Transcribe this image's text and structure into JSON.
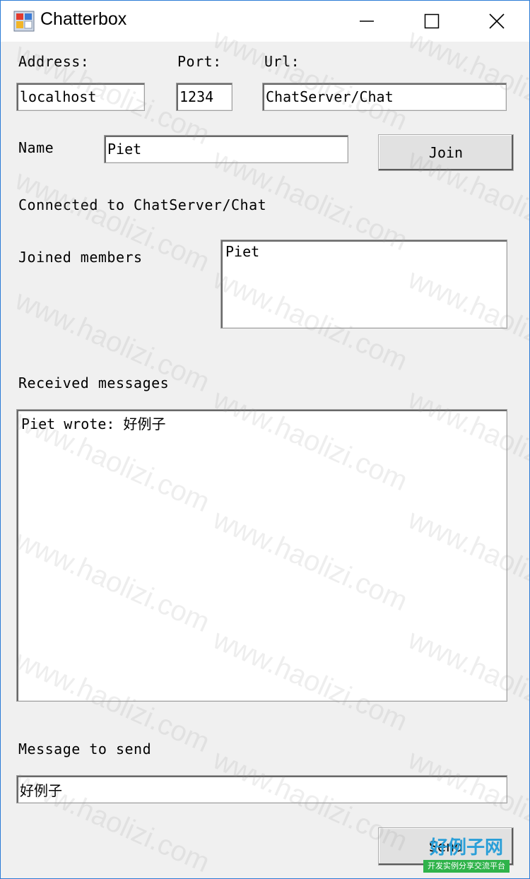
{
  "window": {
    "title": "Chatterbox",
    "icon": "winforms-app-icon",
    "accent": "#2b7bd6"
  },
  "titlebar_controls": {
    "minimize": "minimize-icon",
    "maximize": "maximize-icon",
    "close": "close-icon"
  },
  "connection": {
    "address_label": "Address:",
    "address_value": "localhost",
    "port_label": "Port:",
    "port_value": "1234",
    "url_label": "Url:",
    "url_value": "ChatServer/Chat"
  },
  "user": {
    "name_label": "Name",
    "name_value": "Piet",
    "join_label": "Join"
  },
  "status": {
    "text": "Connected to ChatServer/Chat"
  },
  "members": {
    "label": "Joined members",
    "items": [
      "Piet"
    ]
  },
  "received": {
    "label": "Received messages",
    "messages": [
      "Piet wrote: 好例子"
    ]
  },
  "compose": {
    "label": "Message to send",
    "value": "好例子",
    "send_label": "Send"
  },
  "watermark": {
    "text": "www.haolizi.com"
  },
  "logo": {
    "title": "好例子网",
    "subtitle": "开发实例分享交流平台"
  }
}
